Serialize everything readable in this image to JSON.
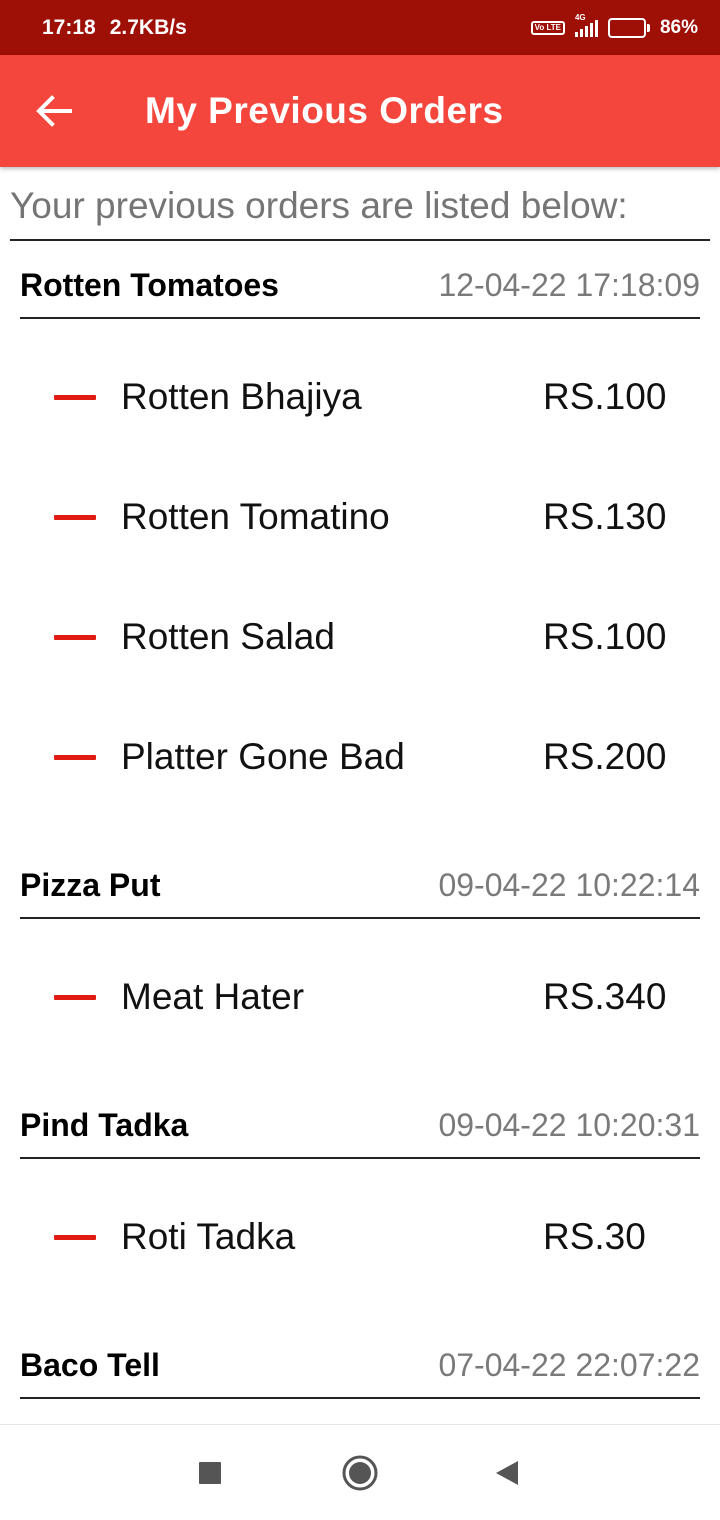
{
  "status_bar": {
    "time": "17:18",
    "speed": "2.7KB/s",
    "volte": "Vo LTE",
    "network": "4G",
    "battery": "86%",
    "battery_level": 0.86
  },
  "app_bar": {
    "title": "My Previous Orders",
    "back_icon": "arrow-back-icon"
  },
  "intro_text": "Your previous orders are listed below:",
  "orders": [
    {
      "restaurant": "Rotten Tomatoes",
      "timestamp": "12-04-22 17:18:09",
      "items": [
        {
          "name": "Rotten Bhajiya",
          "price": "RS.100"
        },
        {
          "name": "Rotten Tomatino",
          "price": "RS.130"
        },
        {
          "name": "Rotten Salad",
          "price": "RS.100"
        },
        {
          "name": "Platter Gone Bad",
          "price": "RS.200"
        }
      ]
    },
    {
      "restaurant": "Pizza Put",
      "timestamp": "09-04-22 10:22:14",
      "items": [
        {
          "name": "Meat Hater",
          "price": "RS.340"
        }
      ]
    },
    {
      "restaurant": "Pind Tadka",
      "timestamp": "09-04-22 10:20:31",
      "items": [
        {
          "name": "Roti Tadka",
          "price": "RS.30"
        }
      ]
    },
    {
      "restaurant": "Baco Tell",
      "timestamp": "07-04-22 22:07:22",
      "items": []
    }
  ],
  "colors": {
    "status_bar": "#9e0f05",
    "app_bar": "#f4463c",
    "dash": "#e01b12",
    "timestamp": "#7a7a7a"
  },
  "nav": {
    "recents_icon": "square-icon",
    "home_icon": "circle-home-icon",
    "back_icon": "triangle-back-icon"
  }
}
